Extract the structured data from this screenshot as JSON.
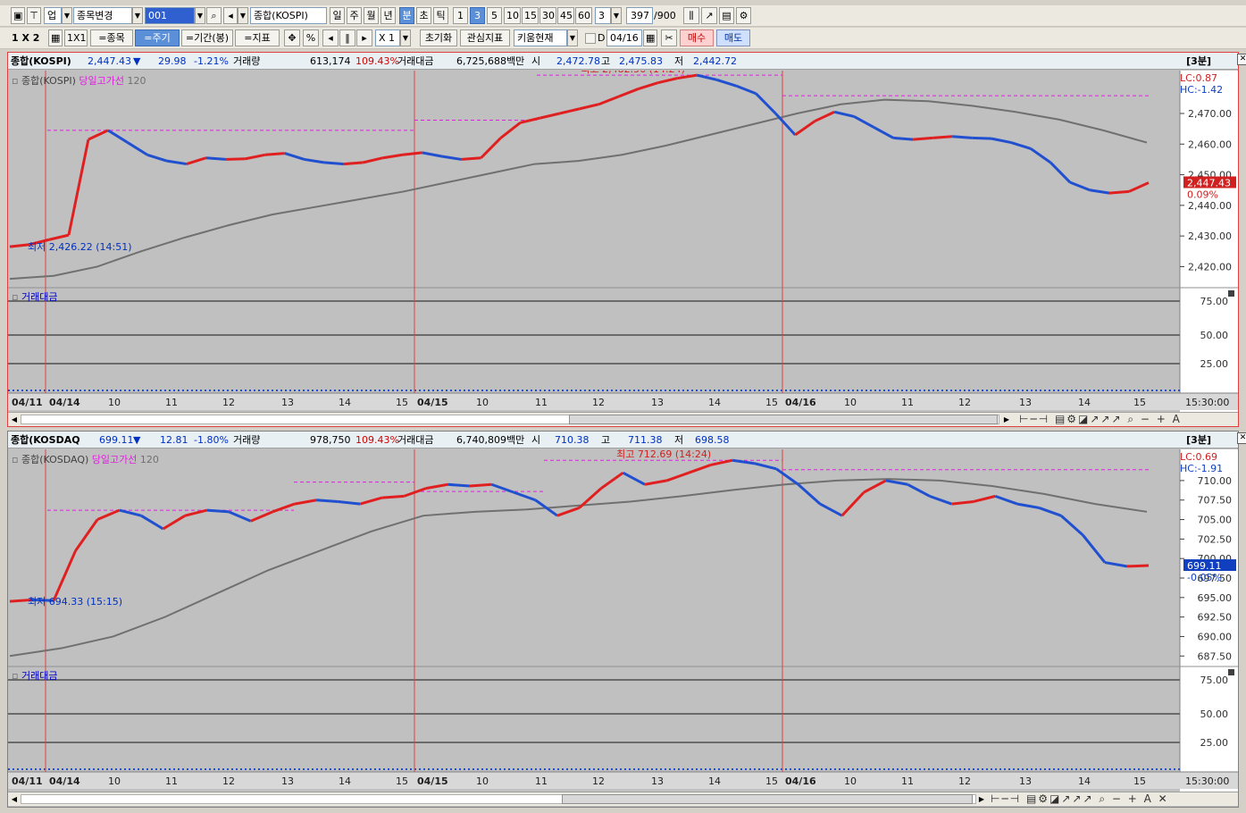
{
  "toolbar1": {
    "market": "업",
    "change_stock": "종목변경",
    "code": "001",
    "name": "종합(KOSPI)",
    "periods": [
      "일",
      "주",
      "월",
      "년",
      "분",
      "초",
      "틱"
    ],
    "active_period": "분",
    "intervals": [
      "1",
      "3",
      "5",
      "10",
      "15",
      "30",
      "45",
      "60"
    ],
    "active_interval": "3",
    "interval_value": "3",
    "count": "397",
    "count_max": "/900"
  },
  "toolbar2": {
    "layout": "1 X 2",
    "layout2": "1X1",
    "btn_stock": "=종목",
    "btn_period": "=주기",
    "btn_range": "=기간(봉)",
    "btn_indicator": "=지표",
    "percent": "%",
    "zoom": "X 1",
    "reset": "초기화",
    "watch_indicator": "관심지표",
    "kiwoom": "키움현재",
    "d_label": "D",
    "date": "04/16",
    "buy": "매수",
    "sell": "매도"
  },
  "panels": [
    {
      "info": {
        "name": "종합(KOSPI)",
        "price": "2,447.43",
        "arrow": "▼",
        "change": "29.98",
        "rate": "-1.21%",
        "vol_label": "거래량",
        "volume": "613,174",
        "vol_rate": "109.43%",
        "amt_label": "거래대금",
        "amount": "6,725,688백만",
        "open_label": "시",
        "open": "2,472.78",
        "high_label": "고",
        "high": "2,475.83",
        "low_label": "저",
        "low": "2,442.72",
        "timeframe": "[3분]"
      },
      "legend": {
        "name": "종합(KOSPI)",
        "ma": "당일고가선",
        "period": "120"
      },
      "lc": "LC:0.87",
      "hc": "HC:-1.42",
      "last_price": "2,447.43",
      "last_rate": "0.09%",
      "last_color": "#d02020",
      "high_note": "최고 2,482.56 (14:24)",
      "low_note": "최저 2,426.22 (14:51)",
      "y_ticks": [
        "2,470.00",
        "2,460.00",
        "2,450.00",
        "2,440.00",
        "2,430.00",
        "2,420.00"
      ],
      "sub_label": "거래대금",
      "sub_ticks": [
        "75.00",
        "50.00",
        "25.00"
      ],
      "x_labels": [
        "04/11",
        "04/14",
        "10",
        "11",
        "12",
        "13",
        "14",
        "15",
        "04/15",
        "10",
        "11",
        "12",
        "13",
        "14",
        "15",
        "04/16",
        "10",
        "11",
        "12",
        "13",
        "14",
        "15"
      ],
      "time": "15:30:00",
      "chart_data": {
        "type": "line",
        "title": "종합(KOSPI)",
        "ylim": [
          2414,
          2484
        ],
        "y_tick_values": [
          2470,
          2460,
          2450,
          2440,
          2430,
          2420
        ],
        "x_labels": [
          "04/11",
          "04/14",
          "10",
          "11",
          "12",
          "13",
          "14",
          "15",
          "04/15",
          "10",
          "11",
          "12",
          "13",
          "14",
          "15",
          "04/16",
          "10",
          "11",
          "12",
          "13",
          "14",
          "15"
        ],
        "series": [
          {
            "name": "종합(KOSPI)",
            "color": "#2050d0",
            "values": [
              2426.5,
              2427.2,
              2428.8,
              2430.3,
              2461.5,
              2464.5,
              2460.5,
              2456.5,
              2454.5,
              2453.5,
              2455.5,
              2455.0,
              2455.2,
              2456.5,
              2457.0,
              2455.0,
              2454.0,
              2453.5,
              2454.0,
              2455.5,
              2456.5,
              2457.2,
              2456.0,
              2455.0,
              2455.5,
              2462.0,
              2467.0,
              2468.5,
              2470.0,
              2471.5,
              2473.0,
              2475.5,
              2478.0,
              2480.0,
              2481.5,
              2482.5,
              2481.0,
              2479.0,
              2476.5,
              2470.0,
              2463.0,
              2467.5,
              2470.5,
              2469.0,
              2465.5,
              2462.0,
              2461.5,
              2462.0,
              2462.5,
              2462.0,
              2461.8,
              2460.5,
              2458.5,
              2454.0,
              2447.5,
              2445.0,
              2444.0,
              2444.5,
              2447.4
            ]
          },
          {
            "name": "당일고가선",
            "color": "#e020e0",
            "values": [
              2464.5,
              2464.5,
              2464.5,
              2482.5,
              2482.5,
              2475.8,
              2475.8
            ]
          },
          {
            "name": "120",
            "color": "#707070",
            "values": [
              2416.0,
              2417.0,
              2420.0,
              2425.0,
              2429.5,
              2433.5,
              2437.0,
              2439.5,
              2442.0,
              2444.5,
              2447.5,
              2450.5,
              2453.5,
              2454.5,
              2456.5,
              2459.5,
              2463.0,
              2466.5,
              2470.0,
              2473.0,
              2474.5,
              2474.0,
              2472.5,
              2470.5,
              2468.0,
              2464.5,
              2460.5
            ]
          }
        ]
      }
    },
    {
      "info": {
        "name": "종합(KOSDAQ",
        "price": "699.11",
        "arrow": "▼",
        "change": "12.81",
        "rate": "-1.80%",
        "vol_label": "거래량",
        "volume": "978,750",
        "vol_rate": "109.43%",
        "amt_label": "거래대금",
        "amount": "6,740,809백만",
        "open_label": "시",
        "open": "710.38",
        "high_label": "고",
        "high": "711.38",
        "low_label": "저",
        "low": "698.58",
        "timeframe": "[3분]"
      },
      "legend": {
        "name": "종합(KOSDAQ)",
        "ma": "당일고가선",
        "period": "120"
      },
      "lc": "LC:0.69",
      "hc": "HC:-1.91",
      "last_price": "699.11",
      "last_rate": "-0.05%",
      "last_color": "#1040c0",
      "high_note": "최고 712.69 (14:24)",
      "low_note": "최저 694.33 (15:15)",
      "y_ticks": [
        "710.00",
        "707.50",
        "705.00",
        "702.50",
        "700.00",
        "697.50",
        "695.00",
        "692.50",
        "690.00",
        "687.50"
      ],
      "sub_label": "거래대금",
      "sub_ticks": [
        "75.00",
        "50.00",
        "25.00"
      ],
      "x_labels": [
        "04/11",
        "04/14",
        "10",
        "11",
        "12",
        "13",
        "14",
        "15",
        "04/15",
        "10",
        "11",
        "12",
        "13",
        "14",
        "15",
        "04/16",
        "10",
        "11",
        "12",
        "13",
        "14",
        "15"
      ],
      "time": "15:30:00",
      "chart_data": {
        "type": "line",
        "title": "종합(KOSDAQ)",
        "ylim": [
          686.5,
          714
        ],
        "y_tick_values": [
          710,
          707.5,
          705,
          702.5,
          700,
          697.5,
          695,
          692.5,
          690,
          687.5
        ],
        "x_labels": [
          "04/11",
          "04/14",
          "10",
          "11",
          "12",
          "13",
          "14",
          "15",
          "04/15",
          "10",
          "11",
          "12",
          "13",
          "14",
          "15",
          "04/16",
          "10",
          "11",
          "12",
          "13",
          "14",
          "15"
        ],
        "series": [
          {
            "name": "종합(KOSDAQ)",
            "color": "#2050d0",
            "values": [
              694.5,
              694.7,
              694.6,
              701.0,
              705.0,
              706.2,
              705.5,
              703.8,
              705.5,
              706.2,
              706.0,
              704.8,
              706.0,
              707.0,
              707.5,
              707.3,
              707.0,
              707.8,
              708.0,
              709.0,
              709.5,
              709.3,
              709.5,
              708.5,
              707.5,
              705.5,
              706.5,
              709.0,
              711.0,
              709.5,
              710.0,
              711.0,
              712.0,
              712.6,
              712.2,
              711.5,
              709.5,
              707.0,
              705.5,
              708.5,
              710.0,
              709.5,
              708.0,
              707.0,
              707.3,
              708.0,
              707.0,
              706.5,
              705.5,
              703.0,
              699.5,
              699.0,
              699.1
            ]
          },
          {
            "name": "당일고가선",
            "color": "#e020e0",
            "values": [
              706.2,
              706.2,
              709.8,
              709.8,
              712.6,
              712.6,
              711.4,
              711.4
            ]
          },
          {
            "name": "120",
            "color": "#707070",
            "values": [
              687.5,
              688.5,
              690.0,
              692.5,
              695.5,
              698.5,
              701.0,
              703.5,
              705.5,
              706.0,
              706.3,
              706.8,
              707.3,
              708.0,
              708.8,
              709.5,
              710.0,
              710.2,
              710.0,
              709.3,
              708.3,
              707.0,
              706.0
            ]
          }
        ]
      }
    }
  ],
  "colors": {
    "up": "#e02020",
    "down": "#2050d0",
    "high_line": "#e020e0",
    "ma": "#707070",
    "background": "#c0c0c0",
    "day_divider": "#e04040"
  }
}
